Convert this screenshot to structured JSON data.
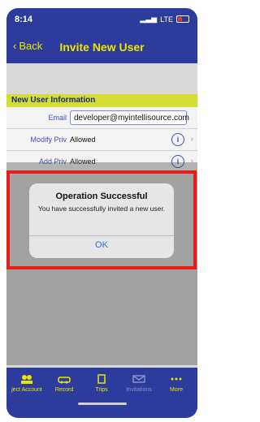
{
  "status": {
    "time": "8:14",
    "carrier": "LTE"
  },
  "nav": {
    "back_label": "Back",
    "title": "Invite New User"
  },
  "form": {
    "section_title": "New User Information",
    "email_label": "Email",
    "email_value": "developer@myintellisource.com",
    "modify_priv_label": "Modify Priv",
    "modify_priv_value": "Allowed",
    "add_priv_label": "Add Priv",
    "add_priv_value": "Allowed"
  },
  "alert": {
    "title": "Operation Successful",
    "message": "You have successfully invited a new user.",
    "ok_label": "OK"
  },
  "tabs": [
    {
      "label": "ject Account",
      "icon": "people-icon"
    },
    {
      "label": "Record",
      "icon": "car-icon"
    },
    {
      "label": "Trips",
      "icon": "document-icon"
    },
    {
      "label": "Invitations",
      "icon": "envelope-icon"
    },
    {
      "label": "More",
      "icon": "more-icon"
    }
  ],
  "colors": {
    "accent": "#e9e600",
    "nav_bg": "#2d3c9c",
    "highlight": "#e51d1d"
  }
}
